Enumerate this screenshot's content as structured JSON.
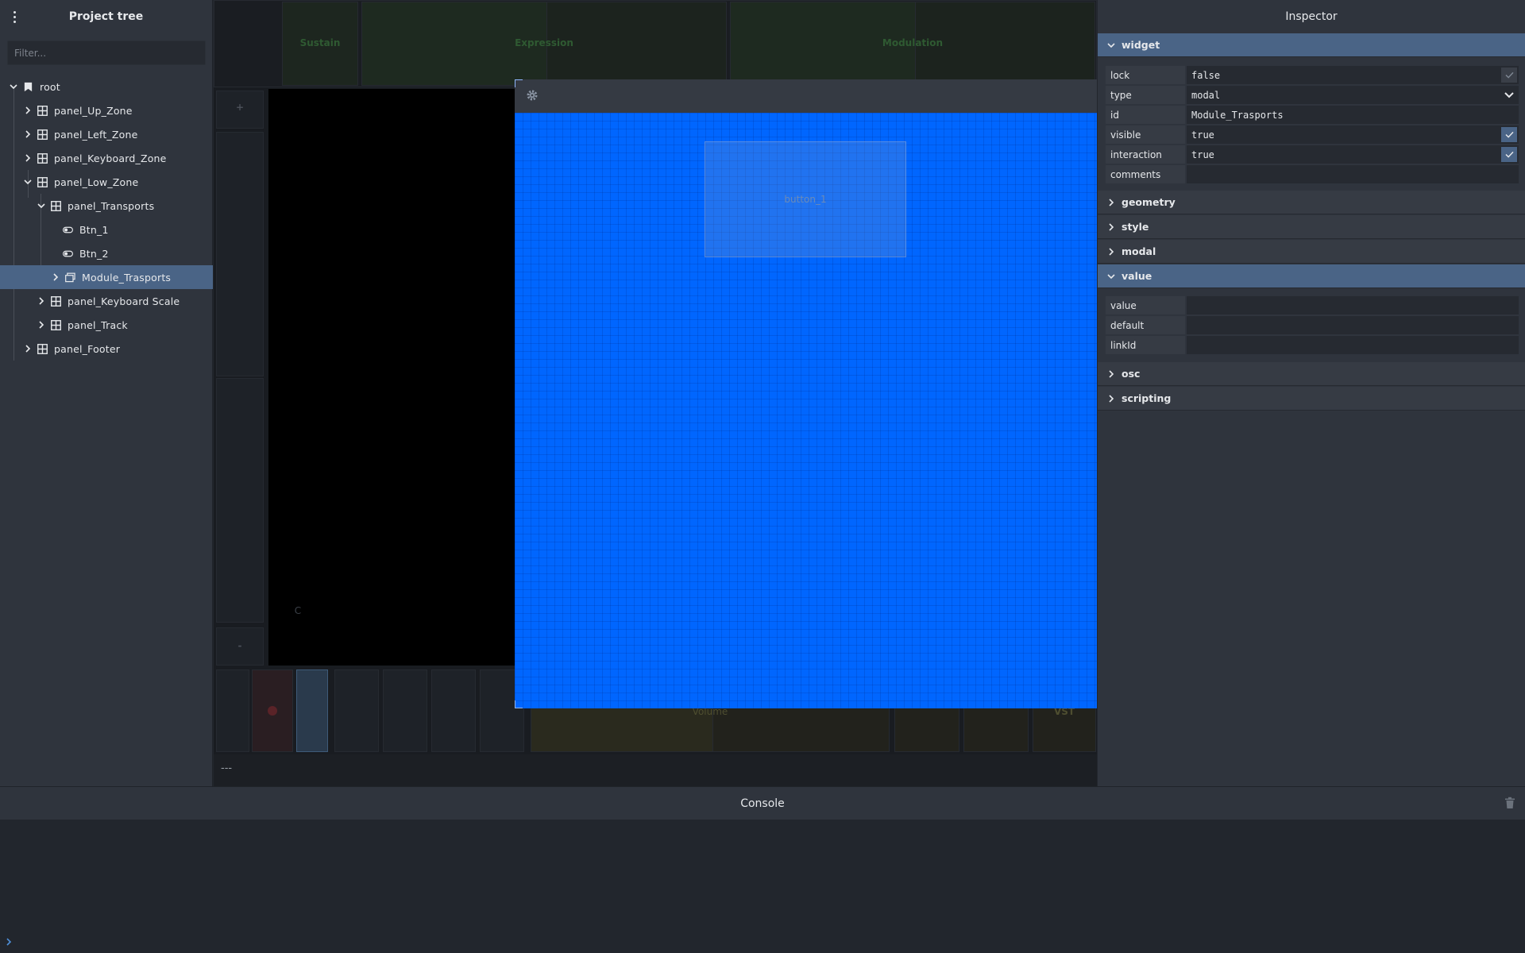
{
  "project_tree": {
    "title": "Project tree",
    "filter_placeholder": "Filter...",
    "items": [
      {
        "label": "root"
      },
      {
        "label": "panel_Up_Zone"
      },
      {
        "label": "panel_Left_Zone"
      },
      {
        "label": "panel_Keyboard_Zone"
      },
      {
        "label": "panel_Low_Zone"
      },
      {
        "label": "panel_Transports"
      },
      {
        "label": "Btn_1"
      },
      {
        "label": "Btn_2"
      },
      {
        "label": "Module_Trasports"
      },
      {
        "label": "panel_Keyboard Scale"
      },
      {
        "label": "panel_Track"
      },
      {
        "label": "panel_Footer"
      }
    ],
    "selected": "Module_Trasports"
  },
  "canvas": {
    "top_labels": [
      "Sustain",
      "Expression",
      "Modulation"
    ],
    "plus_label": "+",
    "minus_label": "-",
    "c_label": "C",
    "bottom_labels": {
      "volume": "Volume",
      "vst": "VST"
    },
    "status_text": "---",
    "modal": {
      "button_label": "button_1",
      "color": "#0066ff"
    }
  },
  "inspector": {
    "title": "Inspector",
    "sections": {
      "widget": "widget",
      "geometry": "geometry",
      "style": "style",
      "modal": "modal",
      "value": "value",
      "osc": "osc",
      "scripting": "scripting"
    },
    "widget_props": {
      "lock": {
        "key": "lock",
        "value": "false"
      },
      "type": {
        "key": "type",
        "value": "modal"
      },
      "id": {
        "key": "id",
        "value": "Module_Trasports"
      },
      "visible": {
        "key": "visible",
        "value": "true"
      },
      "interaction": {
        "key": "interaction",
        "value": "true"
      },
      "comments": {
        "key": "comments",
        "value": ""
      }
    },
    "value_props": {
      "value": {
        "key": "value",
        "value": ""
      },
      "default": {
        "key": "default",
        "value": ""
      },
      "linkId": {
        "key": "linkId",
        "value": ""
      }
    }
  },
  "console": {
    "title": "Console"
  },
  "colors": {
    "selection": "#4a6486",
    "panel": "#2f343d",
    "modal_blue": "#0066ff"
  }
}
